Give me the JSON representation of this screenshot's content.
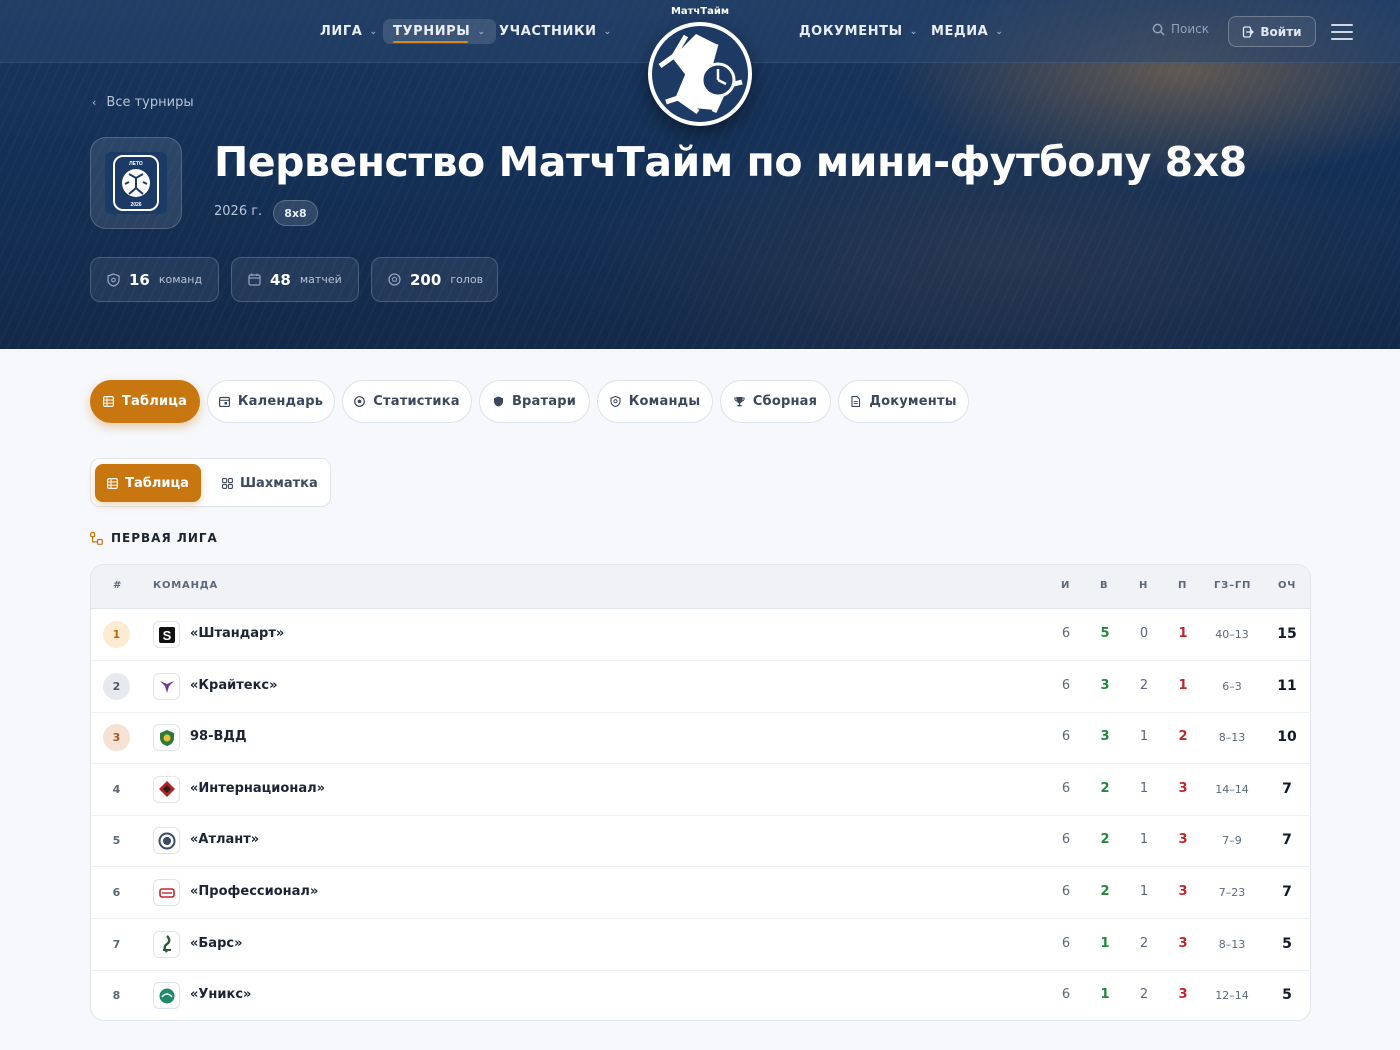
{
  "brand": {
    "name": "МатчТайм"
  },
  "nav": {
    "league": "ЛИГА",
    "tournaments": "ТУРНИРЫ",
    "participants": "УЧАСТНИКИ",
    "documents": "ДОКУМЕНТЫ",
    "media": "МЕДИА",
    "search_label": "Поиск",
    "login_label": "Войти"
  },
  "hero": {
    "back_label": "Все турниры",
    "title": "Первенство МатчТайм по мини-футболу 8х8",
    "year": "2026 г.",
    "format": "8х8",
    "emblem_top": "ЛЕТО",
    "emblem_bottom": "2026",
    "stats": [
      {
        "icon": "shield-icon",
        "value": "16",
        "label": "команд"
      },
      {
        "icon": "calendar-icon",
        "value": "48",
        "label": "матчей"
      },
      {
        "icon": "ball-icon",
        "value": "200",
        "label": "голов"
      }
    ]
  },
  "tabs": [
    {
      "label": "Таблица",
      "icon": "grid-icon",
      "active": true
    },
    {
      "label": "Календарь",
      "icon": "calendar-icon"
    },
    {
      "label": "Статистика",
      "icon": "ball-icon"
    },
    {
      "label": "Вратари",
      "icon": "shield-icon"
    },
    {
      "label": "Команды",
      "icon": "badge-icon"
    },
    {
      "label": "Сборная",
      "icon": "trophy-icon"
    },
    {
      "label": "Документы",
      "icon": "document-icon"
    }
  ],
  "view_toggle": {
    "table": "Таблица",
    "chess": "Шахматка",
    "active": "table"
  },
  "group_title": "ПЕРВАЯ ЛИГА",
  "table": {
    "headers": {
      "pos": "#",
      "team": "КОМАНДА",
      "played": "И",
      "won": "В",
      "drawn": "Н",
      "lost": "П",
      "goals": "ГЗ–ГП",
      "points": "ОЧ"
    },
    "rows": [
      {
        "pos": "1",
        "team": "«Штандарт»",
        "played": "6",
        "won": "5",
        "drawn": "0",
        "lost": "1",
        "goals": "40–13",
        "points": "15"
      },
      {
        "pos": "2",
        "team": "«Крайтекс»",
        "played": "6",
        "won": "3",
        "drawn": "2",
        "lost": "1",
        "goals": "6–3",
        "points": "11"
      },
      {
        "pos": "3",
        "team": "98-ВДД",
        "played": "6",
        "won": "3",
        "drawn": "1",
        "lost": "2",
        "goals": "8–13",
        "points": "10"
      },
      {
        "pos": "4",
        "team": "«Интернационал»",
        "played": "6",
        "won": "2",
        "drawn": "1",
        "lost": "3",
        "goals": "14–14",
        "points": "7"
      },
      {
        "pos": "5",
        "team": "«Атлант»",
        "played": "6",
        "won": "2",
        "drawn": "1",
        "lost": "3",
        "goals": "7–9",
        "points": "7"
      },
      {
        "pos": "6",
        "team": "«Профессионал»",
        "played": "6",
        "won": "2",
        "drawn": "1",
        "lost": "3",
        "goals": "7–23",
        "points": "7"
      },
      {
        "pos": "7",
        "team": "«Барс»",
        "played": "6",
        "won": "1",
        "drawn": "2",
        "lost": "3",
        "goals": "8–13",
        "points": "5"
      },
      {
        "pos": "8",
        "team": "«Уникс»",
        "played": "6",
        "won": "1",
        "drawn": "2",
        "lost": "3",
        "goals": "12–14",
        "points": "5"
      }
    ]
  },
  "colors": {
    "accent": "#c87610",
    "win": "#21883c",
    "loss": "#c2272d",
    "hero_bg": "#143056"
  }
}
